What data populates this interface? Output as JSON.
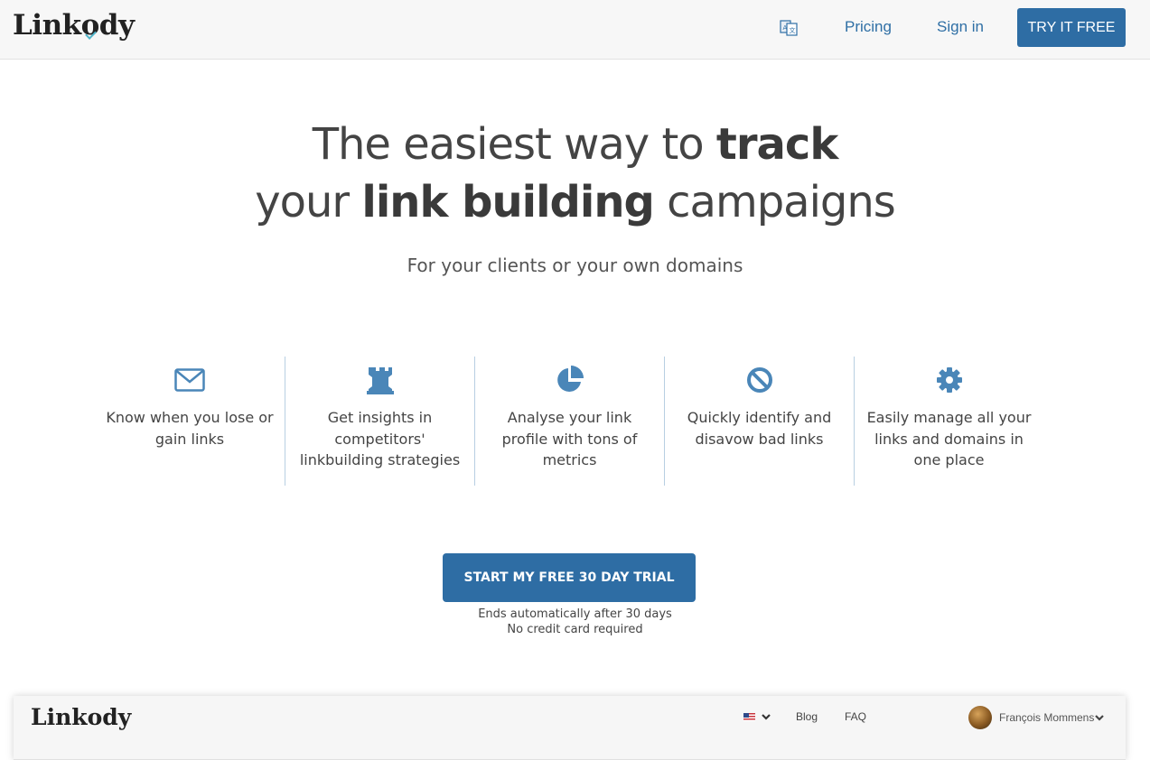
{
  "nav": {
    "logo": "Linkody",
    "translate_icon": "translate-icon",
    "pricing": "Pricing",
    "signin": "Sign in",
    "try_free": "TRY IT FREE"
  },
  "hero": {
    "line1_normal": "The easiest way to ",
    "line1_bold": "track",
    "line2_normal_a": "your ",
    "line2_bold": "link building",
    "line2_normal_b": " campaigns",
    "subtitle": "For your clients or your own domains"
  },
  "features": [
    {
      "icon": "envelope-icon",
      "text": "Know when you lose or gain links"
    },
    {
      "icon": "rook-icon",
      "text": "Get insights in competitors' linkbuilding strategies"
    },
    {
      "icon": "pie-chart-icon",
      "text": "Analyse your link profile with tons of metrics"
    },
    {
      "icon": "ban-icon",
      "text": "Quickly identify and disavow bad links"
    },
    {
      "icon": "gear-icon",
      "text": "Easily manage all your links and domains in one place"
    }
  ],
  "cta": {
    "button": "START MY FREE 30 DAY TRIAL",
    "note1": "Ends automatically after 30 days",
    "note2": "No credit card required"
  },
  "preview": {
    "logo": "Linkody",
    "blog": "Blog",
    "faq": "FAQ",
    "user": "François Mommens"
  },
  "colors": {
    "accent": "#2e6da4",
    "link": "#2f6fa5",
    "icon": "#4a86b8",
    "divider": "#b8cfe2"
  }
}
